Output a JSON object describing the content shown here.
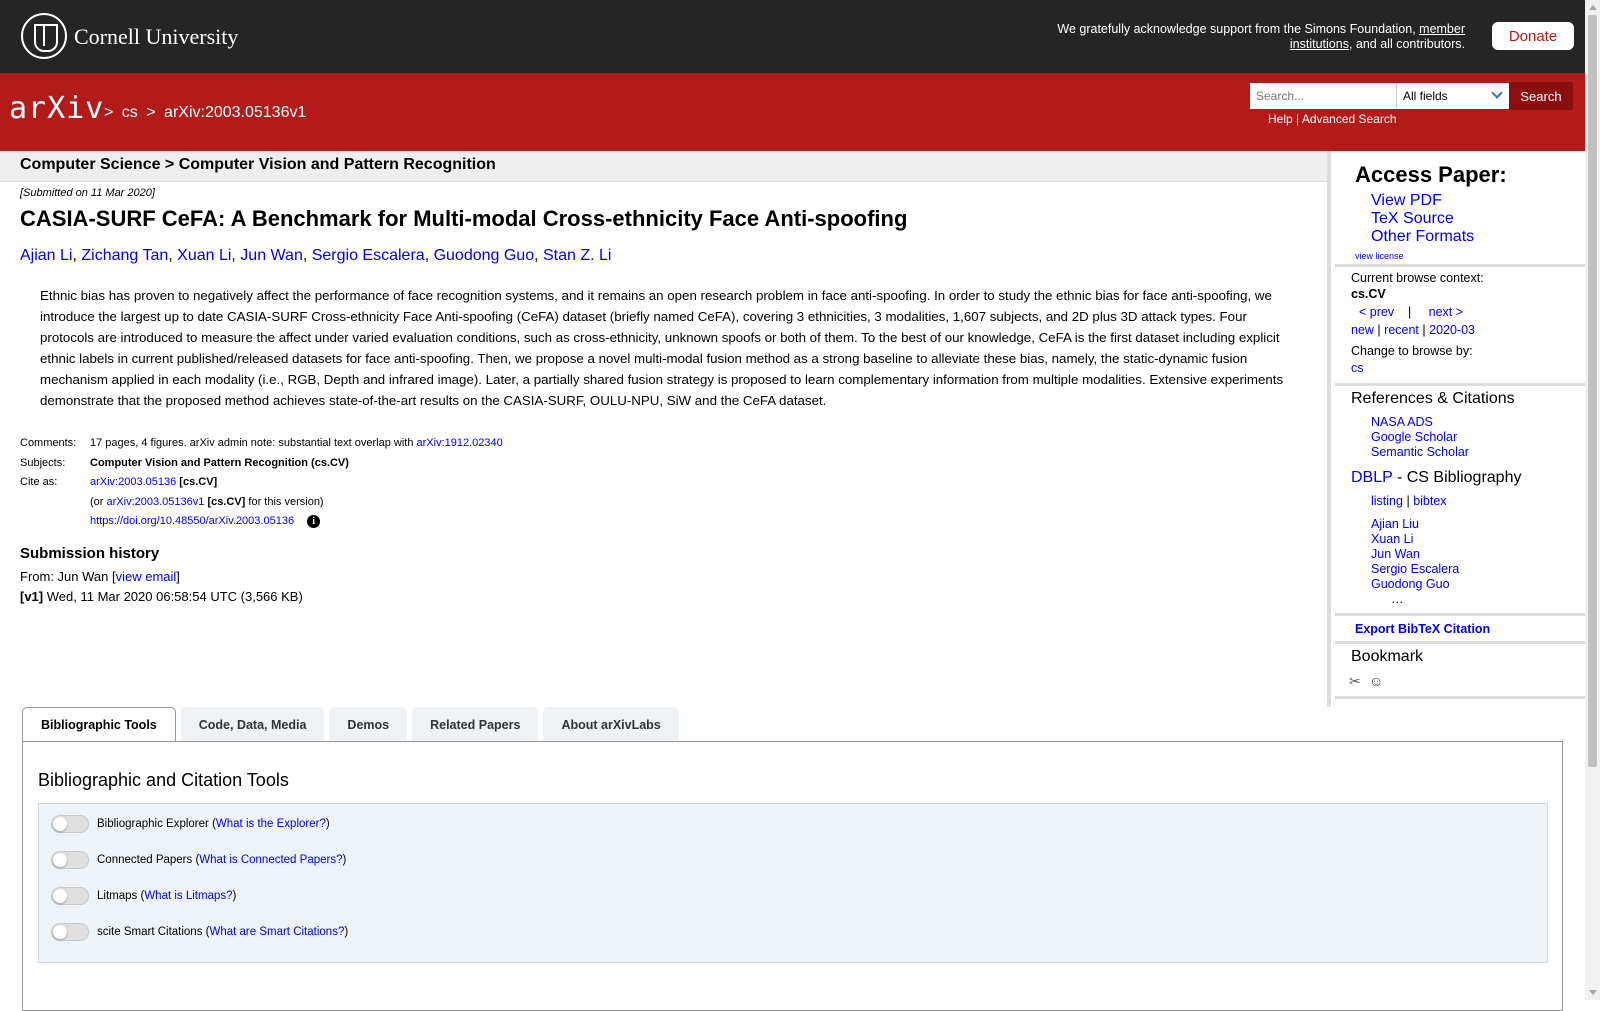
{
  "topbar": {
    "university": "Cornell University",
    "support_prefix": "We gratefully acknowledge support from the Simons Foundation,",
    "support_link": "member institutions",
    "support_suffix": ", and all contributors.",
    "donate": "Donate"
  },
  "header": {
    "logo": "arXiv",
    "breadcrumb": [
      ">",
      "cs",
      ">",
      "arXiv:2003.05136v1"
    ],
    "search_placeholder": "Search...",
    "search_field": "All fields",
    "search_button": "Search",
    "help": "Help",
    "separator": "|",
    "advanced": "Advanced Search"
  },
  "subheader": "Computer Science > Computer Vision and Pattern Recognition",
  "paper": {
    "submitted": "[Submitted on 11 Mar 2020]",
    "title": "CASIA-SURF CeFA: A Benchmark for Multi-modal Cross-ethnicity Face Anti-spoofing",
    "authors": [
      "Ajian Li",
      "Zichang Tan",
      "Xuan Li",
      "Jun Wan",
      "Sergio Escalera",
      "Guodong Guo",
      "Stan Z. Li"
    ],
    "abstract": "Ethnic bias has proven to negatively affect the performance of face recognition systems, and it remains an open research problem in face anti-spoofing. In order to study the ethnic bias for face anti-spoofing, we introduce the largest up to date CASIA-SURF Cross-ethnicity Face Anti-spoofing (CeFA) dataset (briefly named CeFA), covering 3 ethnicities, 3 modalities, 1,607 subjects, and 2D plus 3D attack types. Four protocols are introduced to measure the affect under varied evaluation conditions, such as cross-ethnicity, unknown spoofs or both of them. To the best of our knowledge, CeFA is the first dataset including explicit ethnic labels in current published/released datasets for face anti-spoofing. Then, we propose a novel multi-modal fusion method as a strong baseline to alleviate these bias, namely, the static-dynamic fusion mechanism applied in each modality (i.e., RGB, Depth and infrared image). Later, a partially shared fusion strategy is proposed to learn complementary information from multiple modalities. Extensive experiments demonstrate that the proposed method achieves state-of-the-art results on the CASIA-SURF, OULU-NPU, SiW and the CeFA dataset."
  },
  "meta": {
    "comments_label": "Comments:",
    "comments_text": "17 pages, 4 figures. arXiv admin note: substantial text overlap with",
    "comments_link": "arXiv:1912.02340",
    "subjects_label": "Subjects:",
    "subjects_text": "Computer Vision and Pattern Recognition (cs.CV)",
    "cite_label": "Cite as:",
    "cite_link": "arXiv:2003.05136",
    "cite_tag": "[cs.CV]",
    "cite_v_prefix": "(or",
    "cite_v_link": "arXiv:2003.05136v1",
    "cite_v_tag": "[cs.CV]",
    "cite_v_suffix": "for this version)",
    "doi": "https://doi.org/10.48550/arXiv.2003.05136"
  },
  "history": {
    "title": "Submission history",
    "from_prefix": "From: Jun Wan [",
    "view_email": "view email",
    "from_suffix": "]",
    "v1_tag": "[v1]",
    "v1_text": "Wed, 11 Mar 2020 06:58:54 UTC (3,566 KB)"
  },
  "sidebar": {
    "access_title": "Access Paper:",
    "view_pdf": "View PDF",
    "tex_source": "TeX Source",
    "other_formats": "Other Formats",
    "view_license": "view license",
    "context_label": "Current browse context:",
    "context_value": "cs.CV",
    "prev": "< prev",
    "pipe": "|",
    "next": "next >",
    "new": "new",
    "recent": "recent",
    "month": "2020-03",
    "change_label": "Change to browse by:",
    "change_cs": "cs",
    "refs_title": "References & Citations",
    "nasa": "NASA ADS",
    "google": "Google Scholar",
    "semantic": "Semantic Scholar",
    "dblp": "DBLP",
    "dblp_suffix": " - CS Bibliography",
    "listing": "listing",
    "bibtex": "bibtex",
    "dblp_authors": [
      "Ajian Liu",
      "Xuan Li",
      "Jun Wan",
      "Sergio Escalera",
      "Guodong Guo"
    ],
    "ellipsis": "…",
    "export": "Export BibTeX Citation",
    "bookmark": "Bookmark"
  },
  "tabs": [
    "Bibliographic Tools",
    "Code, Data, Media",
    "Demos",
    "Related Papers",
    "About arXivLabs"
  ],
  "tools": {
    "title": "Bibliographic and Citation Tools",
    "items": [
      {
        "label": "Bibliographic Explorer",
        "link": "What is the Explorer?"
      },
      {
        "label": "Connected Papers",
        "link": "What is Connected Papers?"
      },
      {
        "label": "Litmaps",
        "link": "What is Litmaps?"
      },
      {
        "label": "scite Smart Citations",
        "link": "What are Smart Citations?"
      }
    ]
  },
  "colors": {
    "arxiv_red": "#b31b1b",
    "topbar": "#252525",
    "link": "#0000ee"
  }
}
